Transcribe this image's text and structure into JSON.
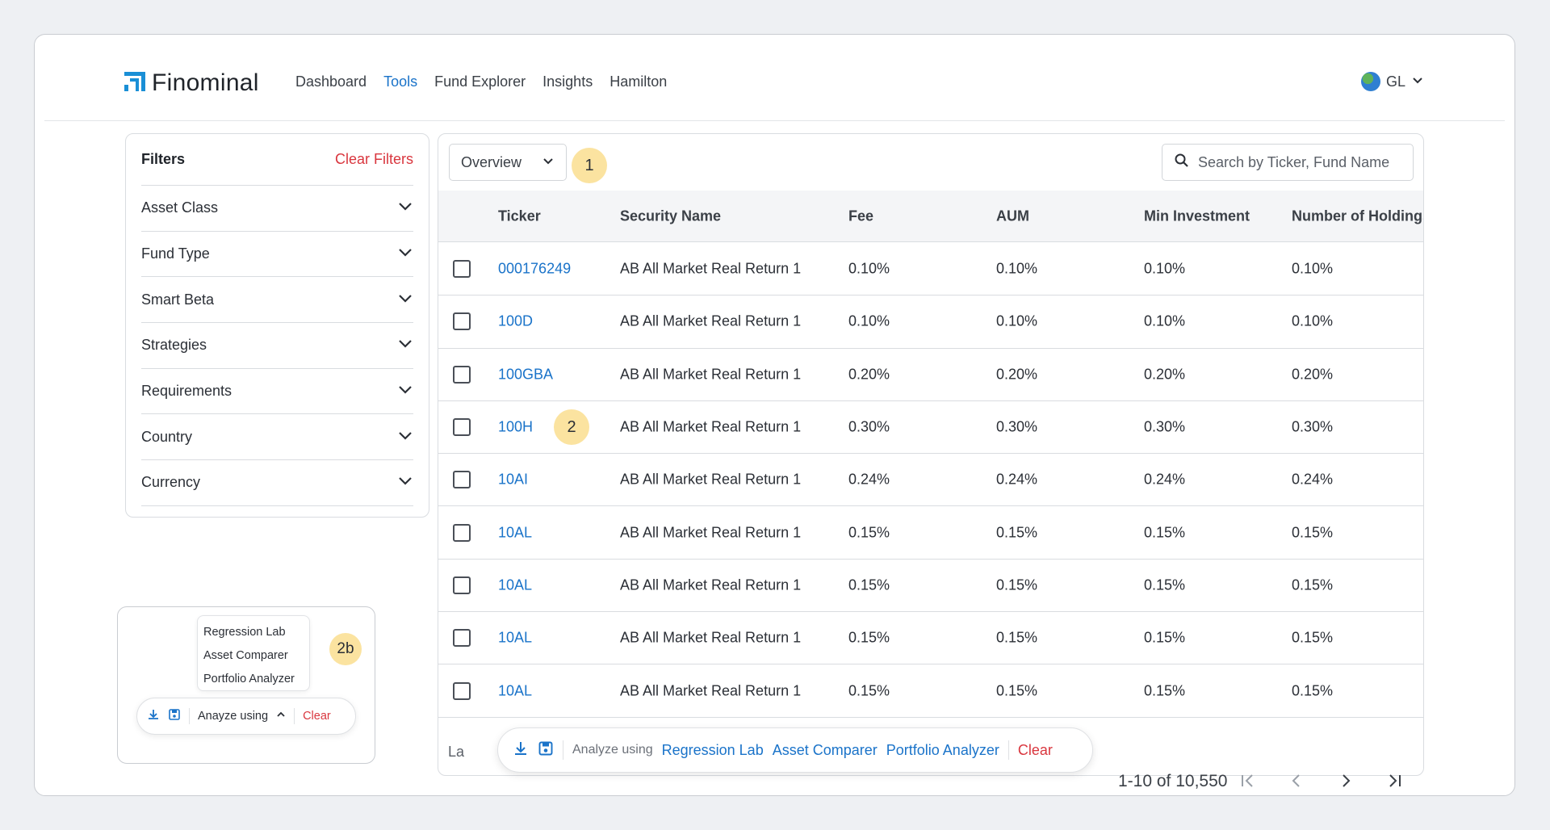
{
  "brand": {
    "name": "Finominal"
  },
  "nav": {
    "items": [
      {
        "label": "Dashboard"
      },
      {
        "label": "Tools"
      },
      {
        "label": "Fund Explorer"
      },
      {
        "label": "Insights"
      },
      {
        "label": "Hamilton"
      }
    ],
    "active": "Tools"
  },
  "region": {
    "label": "GL"
  },
  "filters": {
    "title": "Filters",
    "clear_label": "Clear Filters",
    "items": [
      {
        "label": "Asset Class"
      },
      {
        "label": "Fund Type"
      },
      {
        "label": "Smart Beta"
      },
      {
        "label": "Strategies"
      },
      {
        "label": "Requirements"
      },
      {
        "label": "Country"
      },
      {
        "label": "Currency"
      }
    ]
  },
  "toolbar": {
    "view_label": "Overview",
    "search_placeholder": "Search by Ticker, Fund Name"
  },
  "annotations": {
    "one": "1",
    "two": "2",
    "two_b": "2b"
  },
  "table": {
    "headers": [
      "Ticker",
      "Security Name",
      "Fee",
      "AUM",
      "Min Investment",
      "Number of Holdings"
    ],
    "rows": [
      [
        "000176249",
        "AB All Market Real Return 1",
        "0.10%",
        "0.10%",
        "0.10%",
        "0.10%"
      ],
      [
        "100D",
        "AB All Market Real Return 1",
        "0.10%",
        "0.10%",
        "0.10%",
        "0.10%"
      ],
      [
        "100GBA",
        "AB All Market Real Return 1",
        "0.20%",
        "0.20%",
        "0.20%",
        "0.20%"
      ],
      [
        "100H",
        "AB All Market Real Return 1",
        "0.30%",
        "0.30%",
        "0.30%",
        "0.30%"
      ],
      [
        "10AI",
        "AB All Market Real Return 1",
        "0.24%",
        "0.24%",
        "0.24%",
        "0.24%"
      ],
      [
        "10AL",
        "AB All Market Real Return 1",
        "0.15%",
        "0.15%",
        "0.15%",
        "0.15%"
      ],
      [
        "10AL",
        "AB All Market Real Return 1",
        "0.15%",
        "0.15%",
        "0.15%",
        "0.15%"
      ],
      [
        "10AL",
        "AB All Market Real Return 1",
        "0.15%",
        "0.15%",
        "0.15%",
        "0.15%"
      ],
      [
        "10AL",
        "AB All Market Real Return 1",
        "0.15%",
        "0.15%",
        "0.15%",
        "0.15%"
      ]
    ]
  },
  "footer": {
    "left_fragment": "La",
    "page_count": "1-10 of 10,550"
  },
  "action_bar": {
    "analyze_label": "Analyze using",
    "tools": [
      "Regression Lab",
      "Asset Comparer",
      "Portfolio Analyzer"
    ],
    "clear_label": "Clear"
  },
  "mini_action_bar": {
    "analyze_label": "Anayze using",
    "menu": [
      "Regression Lab",
      "Asset Comparer",
      "Portfolio Analyzer"
    ],
    "clear_label": "Clear"
  },
  "colors": {
    "accent": "#1a73c9",
    "danger": "#d9363e",
    "highlight": "#fbe3a0"
  },
  "icons": [
    "logo-icon",
    "globe-icon",
    "chevron-down-icon",
    "search-icon",
    "download-icon",
    "save-icon",
    "chevron-up-icon",
    "first-page-icon",
    "prev-page-icon",
    "next-page-icon",
    "last-page-icon"
  ]
}
